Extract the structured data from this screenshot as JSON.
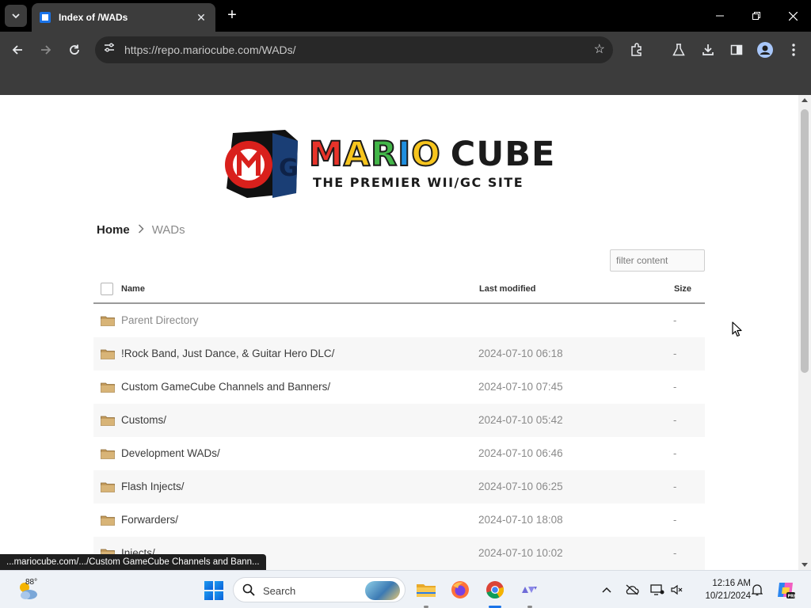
{
  "browser": {
    "tab_title": "Index of /WADs",
    "url": "https://repo.mariocube.com/WADs/"
  },
  "logo": {
    "word_mario": "MARIO",
    "word_cube": "CUBE",
    "tagline": "THE PREMIER WII/GC SITE",
    "colors": {
      "red": "#e8332a",
      "yellow": "#f7c51e",
      "green": "#43b649",
      "blue": "#1f8fe0",
      "dark": "#1b1b1b"
    }
  },
  "breadcrumb": {
    "home": "Home",
    "separator": ">",
    "current": "WADs"
  },
  "filter": {
    "placeholder": "filter content"
  },
  "table": {
    "headers": {
      "name": "Name",
      "modified": "Last modified",
      "size": "Size"
    },
    "rows": [
      {
        "name": "Parent Directory",
        "modified": "",
        "size": "-"
      },
      {
        "name": "!Rock Band, Just Dance, & Guitar Hero DLC/",
        "modified": "2024-07-10 06:18",
        "size": "-"
      },
      {
        "name": "Custom GameCube Channels and Banners/",
        "modified": "2024-07-10 07:45",
        "size": "-"
      },
      {
        "name": "Customs/",
        "modified": "2024-07-10 05:42",
        "size": "-"
      },
      {
        "name": "Development WADs/",
        "modified": "2024-07-10 06:46",
        "size": "-"
      },
      {
        "name": "Flash Injects/",
        "modified": "2024-07-10 06:25",
        "size": "-"
      },
      {
        "name": "Forwarders/",
        "modified": "2024-07-10 18:08",
        "size": "-"
      },
      {
        "name": "Injects/",
        "modified": "2024-07-10 10:02",
        "size": "-"
      }
    ]
  },
  "status_bar": {
    "text": "...mariocube.com/.../Custom GameCube Channels and Bann..."
  },
  "taskbar": {
    "weather_temp": "88°",
    "search_label": "Search",
    "clock_time": "12:16 AM",
    "clock_date": "10/21/2024"
  }
}
